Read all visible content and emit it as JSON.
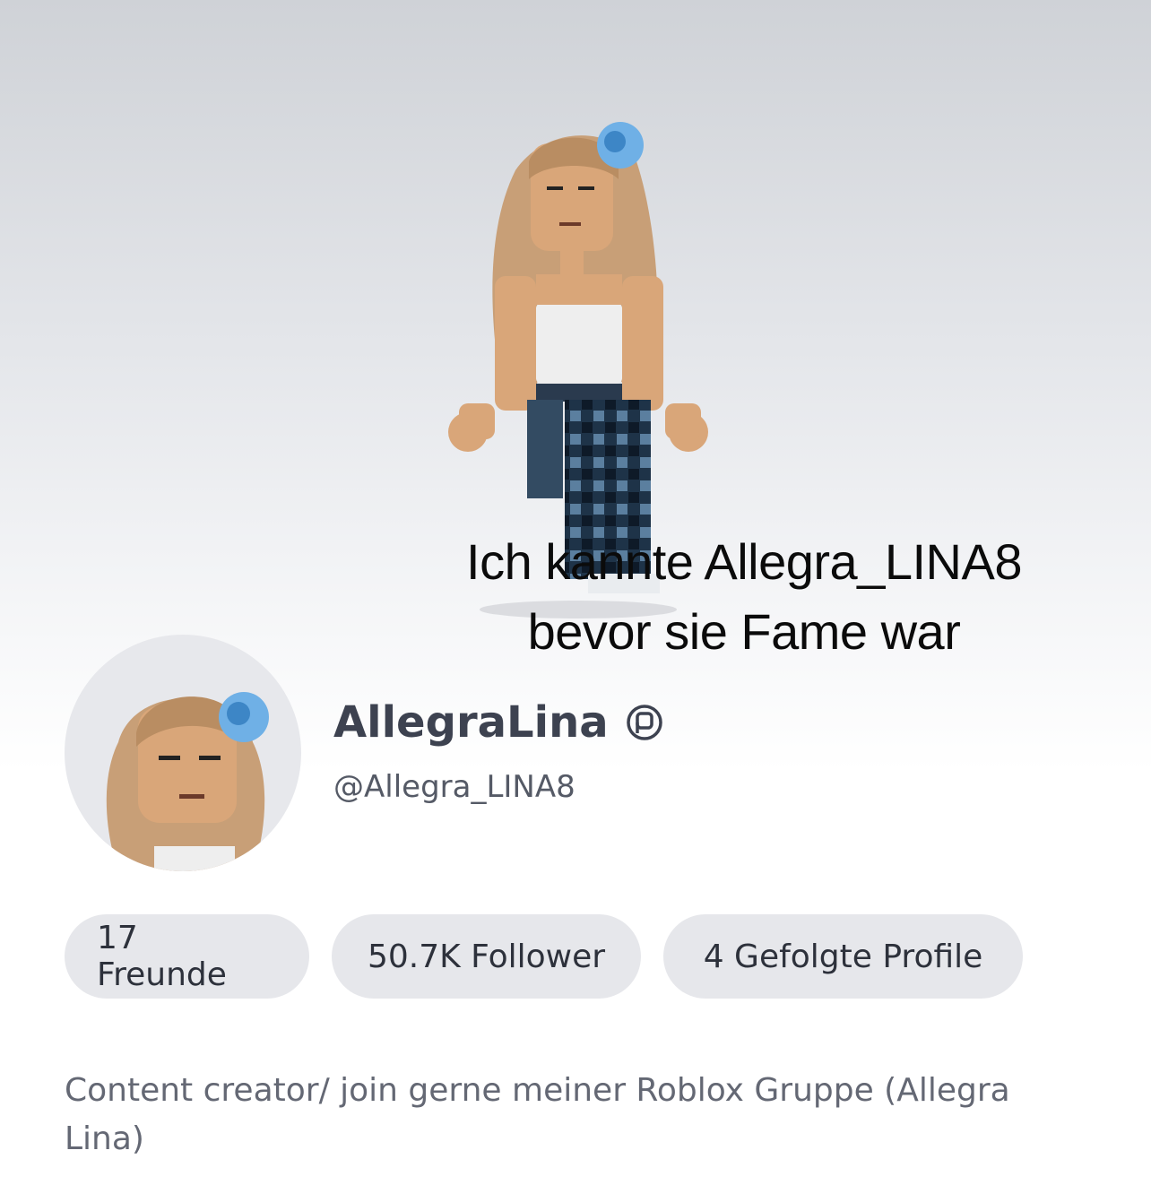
{
  "overlay": {
    "line1": "Ich kannte Allegra_LINA8",
    "line2": "bevor sie Fame war"
  },
  "profile": {
    "display_name": "AllegraLina",
    "username": "@Allegra_LINA8",
    "verified_icon": "verified-badge-icon"
  },
  "stats": {
    "friends": "17 Freunde",
    "followers": "50.7K Follower",
    "following": "4 Gefolgte Profile"
  },
  "bio": "Content creator/ join gerne meiner Roblox Gruppe (Allegra Lina)",
  "colors": {
    "hero_top": "#cfd2d7",
    "pill_bg": "#e6e7eb",
    "name_text": "#3d4250",
    "bio_text": "#646874"
  }
}
